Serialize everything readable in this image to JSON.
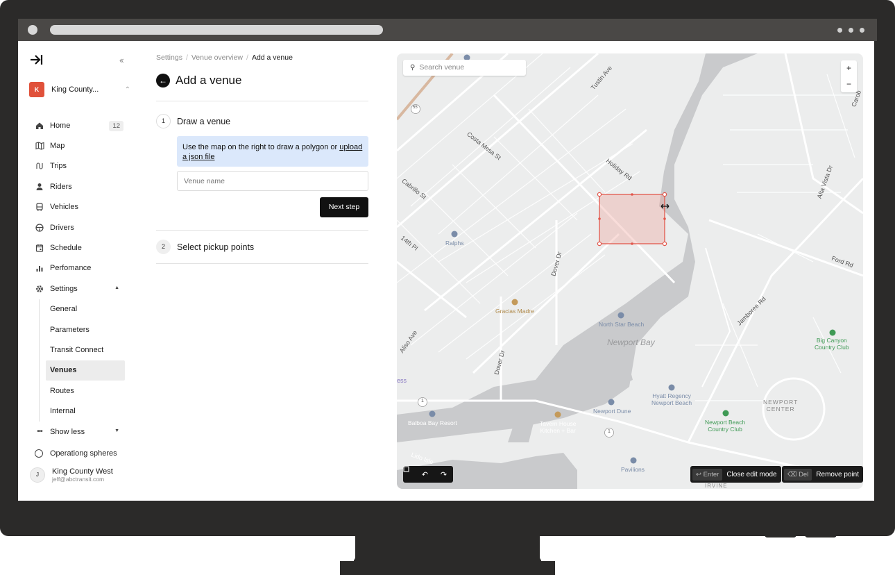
{
  "sidebar": {
    "org_badge": "K",
    "org_name": "King County...",
    "nav": [
      {
        "label": "Home",
        "count": "12"
      },
      {
        "label": "Map"
      },
      {
        "label": "Trips"
      },
      {
        "label": "Riders"
      },
      {
        "label": "Vehicles"
      },
      {
        "label": "Drivers"
      },
      {
        "label": "Schedule"
      },
      {
        "label": "Perfomance"
      },
      {
        "label": "Settings"
      }
    ],
    "settings_sub": [
      "General",
      "Parameters",
      "Transit Connect",
      "Venues",
      "Routes",
      "Internal"
    ],
    "active_sub": "Venues",
    "show_less": "Show less",
    "operating_spheres": "Operationg spheres",
    "user": {
      "avatar": "J",
      "name": "King County West",
      "email": "jeff@abctransit.com"
    }
  },
  "breadcrumb": {
    "items": [
      "Settings",
      "Venue overview"
    ],
    "current": "Add a venue"
  },
  "page_title": "Add a venue",
  "steps": [
    {
      "number": "1",
      "title": "Draw a venue"
    },
    {
      "number": "2",
      "title": "Select pickup points"
    }
  ],
  "step1": {
    "info_text": "Use the map on the right to draw a polygon or ",
    "info_link": "upload a json file",
    "venue_name_placeholder": "Venue name",
    "next_button": "Next step"
  },
  "map": {
    "search_placeholder": "Search venue",
    "zoom_in": "+",
    "zoom_out": "−",
    "road_labels": {
      "tustin": "Tustin Ave",
      "costa_mesa": "Costa Mesa St",
      "holiday": "Holiday Rd",
      "cabrillo": "Cabrillo St",
      "fourteenth": "14th Pl",
      "dover1": "Dover Dr",
      "dover2": "Dover Dr",
      "aliso": "Aliso Ave",
      "jamboree": "Jamboree Rd",
      "ford": "Ford Rd",
      "alta_vista": "Alta Vista Dr",
      "lido": "Lido Isle",
      "carob": "Carob",
      "hwy55": "55",
      "hwy1a": "1",
      "hwy1b": "1",
      "ess": "ess",
      "irvine": "IRVINE"
    },
    "water_label": "Newport Bay",
    "area_label": "NEWPORT\nCENTER",
    "pois": {
      "ralphs": "Ralphs",
      "gracias": "Gracias Madre",
      "northstar": "North Star Beach",
      "big_canyon": "Big Canyon\nCountry Club",
      "hyatt": "Hyatt Regency\nNewport Beach",
      "dune": "Newport Dune",
      "balboa": "Balboa Bay Resort",
      "tavern": "Tavern House\nKitchen + Bar",
      "newport_cc": "Newport Beach\nCountry Club",
      "pavilions": "Pavilions"
    },
    "hint_enter_key": "↩ Enter",
    "hint_enter_label": "Close edit mode",
    "hint_del_key": "⌫ Del",
    "hint_del_label": "Remove point"
  }
}
